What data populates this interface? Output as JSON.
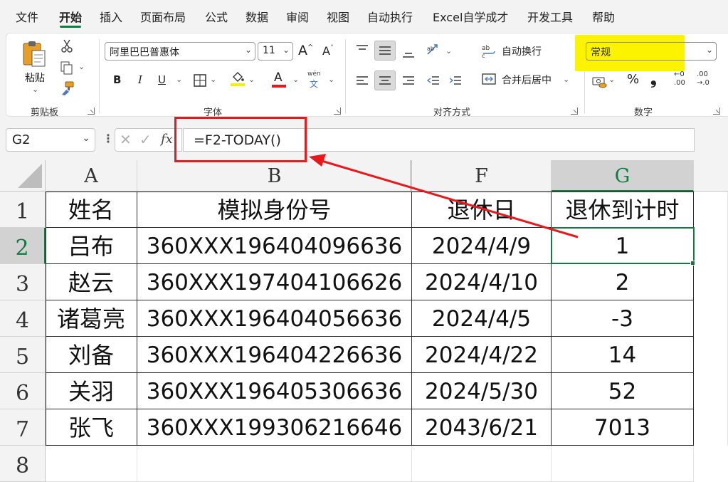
{
  "menu": {
    "tabs": [
      "文件",
      "开始",
      "插入",
      "页面布局",
      "公式",
      "数据",
      "审阅",
      "视图",
      "自动执行",
      "Excel自学成才",
      "开发工具",
      "帮助"
    ],
    "active_tab": "开始"
  },
  "ribbon": {
    "clipboard": {
      "paste_label": "粘贴",
      "group_label": "剪贴板"
    },
    "font": {
      "font_name": "阿里巴巴普惠体",
      "font_size": "11",
      "grow": "A",
      "shrink": "A",
      "bold": "B",
      "italic": "I",
      "underline": "U",
      "font_color_glyph": "A",
      "phonetic_top": "wén",
      "phonetic_bottom": "文",
      "group_label": "字体"
    },
    "alignment": {
      "wrap_text": "自动换行",
      "merge_center": "合并后居中",
      "group_label": "对齐方式"
    },
    "number": {
      "format": "常规",
      "percent": "%",
      "comma": "❟",
      "group_label": "数字",
      "dec_increase_top": "←0",
      "dec_increase_bottom": ".00",
      "dec_decrease_top": ".00",
      "dec_decrease_bottom": "→.0"
    }
  },
  "formula_bar": {
    "name_box": "G2",
    "fx": "fx",
    "formula": "=F2-TODAY()"
  },
  "sheet": {
    "columns": [
      "A",
      "B",
      "F",
      "G"
    ],
    "selected_column": "G",
    "rows": [
      "1",
      "2",
      "3",
      "4",
      "5",
      "6",
      "7",
      "8"
    ],
    "selected_row": "2",
    "headers": [
      "姓名",
      "模拟身份号",
      "退休日",
      "退休到计时"
    ],
    "data": [
      [
        "吕布",
        "360XXX196404096636",
        "2024/4/9",
        "1"
      ],
      [
        "赵云",
        "360XXX197404106626",
        "2024/4/10",
        "2"
      ],
      [
        "诸葛亮",
        "360XXX196404056636",
        "2024/4/5",
        "-3"
      ],
      [
        "刘备",
        "360XXX196404226636",
        "2024/4/22",
        "14"
      ],
      [
        "关羽",
        "360XXX196405306636",
        "2024/5/30",
        "52"
      ],
      [
        "张飞",
        "360XXX199306216646",
        "2043/6/21",
        "7013"
      ]
    ]
  },
  "colors": {
    "accent_green": "#107c41",
    "annotation_red": "#e8191c",
    "highlight_yellow": "#fbf300"
  }
}
